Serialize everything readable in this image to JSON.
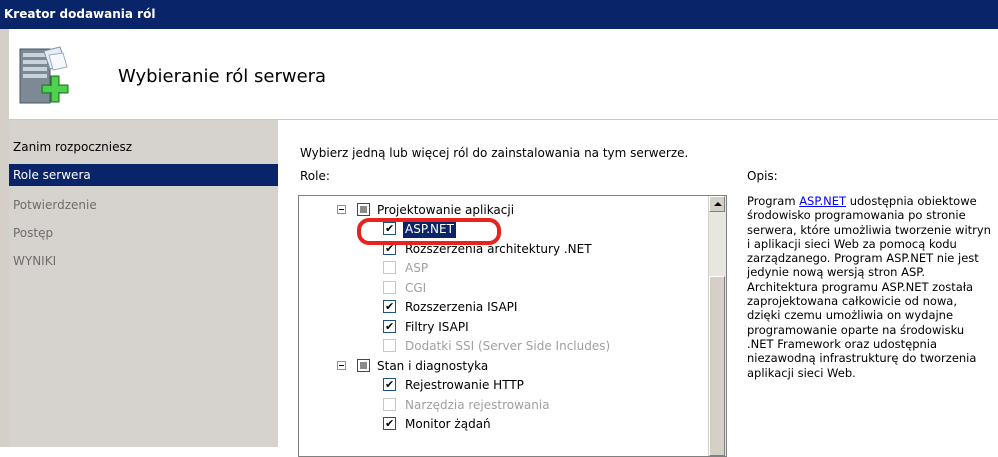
{
  "window": {
    "title": "Kreator dodawania ról"
  },
  "header": {
    "title": "Wybieranie ról serwera",
    "icon": "server-add-icon"
  },
  "nav": {
    "items": [
      {
        "label": "Zanim rozpoczniesz",
        "state": "normal"
      },
      {
        "label": "Role serwera",
        "state": "active"
      },
      {
        "label": "Potwierdzenie",
        "state": "dim"
      },
      {
        "label": "Postęp",
        "state": "dim"
      },
      {
        "label": "WYNIKI",
        "state": "dim"
      }
    ]
  },
  "main": {
    "instruction": "Wybierz jedną lub więcej ról do zainstalowania na tym serwerze.",
    "roles_label": "Role:",
    "description_label": "Opis:",
    "tree": [
      {
        "label": "Projektowanie aplikacji",
        "level": 1,
        "expander": "minus",
        "checkbox": "partial",
        "enabled": true
      },
      {
        "label": "ASP.NET",
        "level": 2,
        "checkbox": "checked",
        "enabled": true,
        "selected": true
      },
      {
        "label": "Rozszerzenia architektury .NET",
        "level": 2,
        "checkbox": "checked",
        "enabled": true
      },
      {
        "label": "ASP",
        "level": 2,
        "checkbox": "unchecked",
        "enabled": false
      },
      {
        "label": "CGI",
        "level": 2,
        "checkbox": "unchecked",
        "enabled": false
      },
      {
        "label": "Rozszerzenia ISAPI",
        "level": 2,
        "checkbox": "checked",
        "enabled": true
      },
      {
        "label": "Filtry ISAPI",
        "level": 2,
        "checkbox": "checked",
        "enabled": true
      },
      {
        "label": "Dodatki SSI (Server Side Includes)",
        "level": 2,
        "checkbox": "unchecked",
        "enabled": false
      },
      {
        "label": "Stan i diagnostyka",
        "level": 1,
        "expander": "minus",
        "checkbox": "partial",
        "enabled": true
      },
      {
        "label": "Rejestrowanie HTTP",
        "level": 2,
        "checkbox": "checked",
        "enabled": true
      },
      {
        "label": "Narzędzia rejestrowania",
        "level": 2,
        "checkbox": "unchecked",
        "enabled": false
      },
      {
        "label": "Monitor żądań",
        "level": 2,
        "checkbox": "checked",
        "enabled": true
      }
    ],
    "description": {
      "prefix": "Program ",
      "link": "ASP.NET",
      "rest": " udostępnia obiektowe środowisko programowania po stronie serwera, które umożliwia tworzenie witryn i aplikacji sieci Web za pomocą kodu zarządzanego. Program ASP.NET nie jest jedynie nową wersją stron ASP. Architektura programu ASP.NET została zaprojektowana całkowicie od nowa, dzięki czemu umożliwia on wydajne programowanie oparte na środowisku .NET Framework oraz udostępnia niezawodną infrastrukturę do tworzenia aplikacji sieci Web."
    }
  },
  "colors": {
    "titlebar": "#0a246a",
    "nav_bg": "#d6d3ce",
    "highlight": "#e8221c",
    "link": "#0000ff"
  }
}
